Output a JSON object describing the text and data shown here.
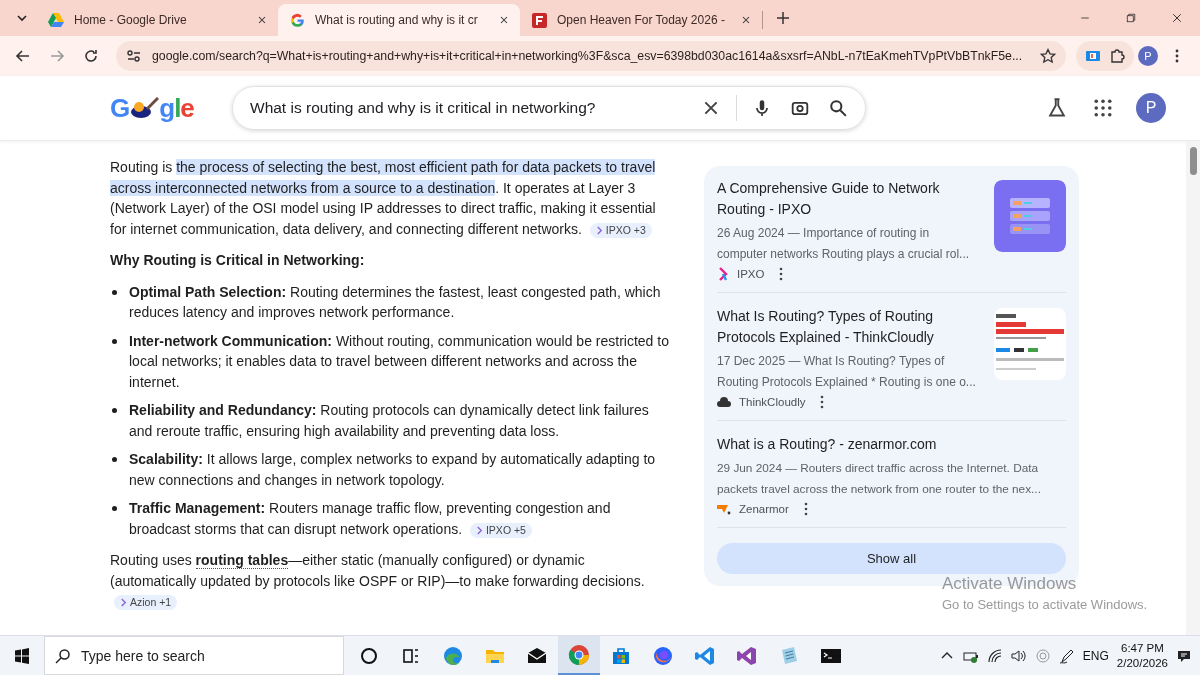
{
  "browser": {
    "tabs": [
      {
        "title": "Home - Google Drive",
        "selected": false
      },
      {
        "title": "What is routing and why is it cr",
        "selected": true
      },
      {
        "title": "Open Heaven For Today 2026 -",
        "selected": false
      }
    ],
    "url": "google.com/search?q=What+is+routing+and+why+is+it+critical+in+networking%3F&sca_esv=6398bd030ac1614a&sxsrf=ANbL-n7tEaKmehTVpPtVbBTnkF5e...",
    "profile": "P"
  },
  "search": {
    "logo_left": "G",
    "logo_right": "gle",
    "query": "What is routing and why is it critical in networking?",
    "profile": "P"
  },
  "overview": [
    {
      "kind": "paragraph",
      "segments": [
        {
          "text": "Routing is ",
          "highlighted": false
        },
        {
          "text": "the process of selecting the best, most efficient path for data packets to travel across interconnected networks from a source to a destination",
          "highlighted": true
        },
        {
          "text": ". It operates at Layer 3 (Network Layer) of the OSI model using IP addresses to direct traffic, making it essential for internet communication, data delivery, and connecting different networks.",
          "highlighted": false
        }
      ],
      "citation": "IPXO +3"
    },
    {
      "kind": "heading",
      "text": "Why Routing is Critical in Networking:"
    },
    {
      "kind": "list",
      "items": [
        {
          "text": "**Optimal Path Selection:** Routing determines the fastest, least congested path, which reduces latency and improves network performance."
        },
        {
          "text": "**Inter-network Communication:** Without routing, communication would be restricted to local networks; it enables data to travel between different networks and across the internet."
        },
        {
          "text": "**Reliability and Redundancy:** Routing protocols can dynamically detect link failures and reroute traffic, ensuring high availability and preventing data loss."
        },
        {
          "text": "**Scalability:** It allows large, complex networks to expand by automatically adapting to new connections and changes in network topology."
        },
        {
          "text": "**Traffic Management:** Routers manage traffic flow, preventing congestion and broadcast storms that can disrupt network operations.",
          "citation": "IPXO +5"
        }
      ]
    },
    {
      "kind": "rich",
      "text": "Routing uses **routing tables**—either static (manually configured) or dynamic (automatically updated by protocols like OSPF or RIP)—to make forwarding decisions.",
      "citation": "Azion +1"
    }
  ],
  "sources": [
    {
      "title": "A Comprehensive Guide to Network Routing - IPXO",
      "snippet": "26 Aug 2024 — Importance of routing in computer networks Routing plays a crucial rol...",
      "source": "IPXO"
    },
    {
      "title": "What Is Routing? Types of Routing Protocols Explained - ThinkCloudly",
      "snippet": "17 Dec 2025 — What Is Routing? Types of Routing Protocols Explained * Routing is one o...",
      "source": "ThinkCloudly"
    },
    {
      "title": "What is a Routing? - zenarmor.com",
      "snippet": "29 Jun 2024 — Routers direct traffic across the Internet. Data packets travel across the network from one router to the nex...",
      "source": "Zenarmor"
    }
  ],
  "show_all": "Show all",
  "activation": {
    "title": "Activate Windows",
    "subtitle": "Go to Settings to activate Windows."
  },
  "taskbar": {
    "search_placeholder": "Type here to search",
    "apps": [
      {
        "kind": "cortana",
        "active": false
      },
      {
        "kind": "taskview",
        "active": false
      },
      {
        "kind": "edge",
        "active": false
      },
      {
        "kind": "folder",
        "active": false
      },
      {
        "kind": "mail",
        "active": false
      },
      {
        "kind": "chrome",
        "active": true
      },
      {
        "kind": "store",
        "active": false
      },
      {
        "kind": "firefox",
        "active": false
      },
      {
        "kind": "vscode",
        "active": false
      },
      {
        "kind": "vs",
        "active": false
      },
      {
        "kind": "notepad",
        "active": false
      },
      {
        "kind": "terminal",
        "active": false
      }
    ],
    "language": "ENG",
    "time": "6:47 PM",
    "date": "2/20/2026"
  }
}
